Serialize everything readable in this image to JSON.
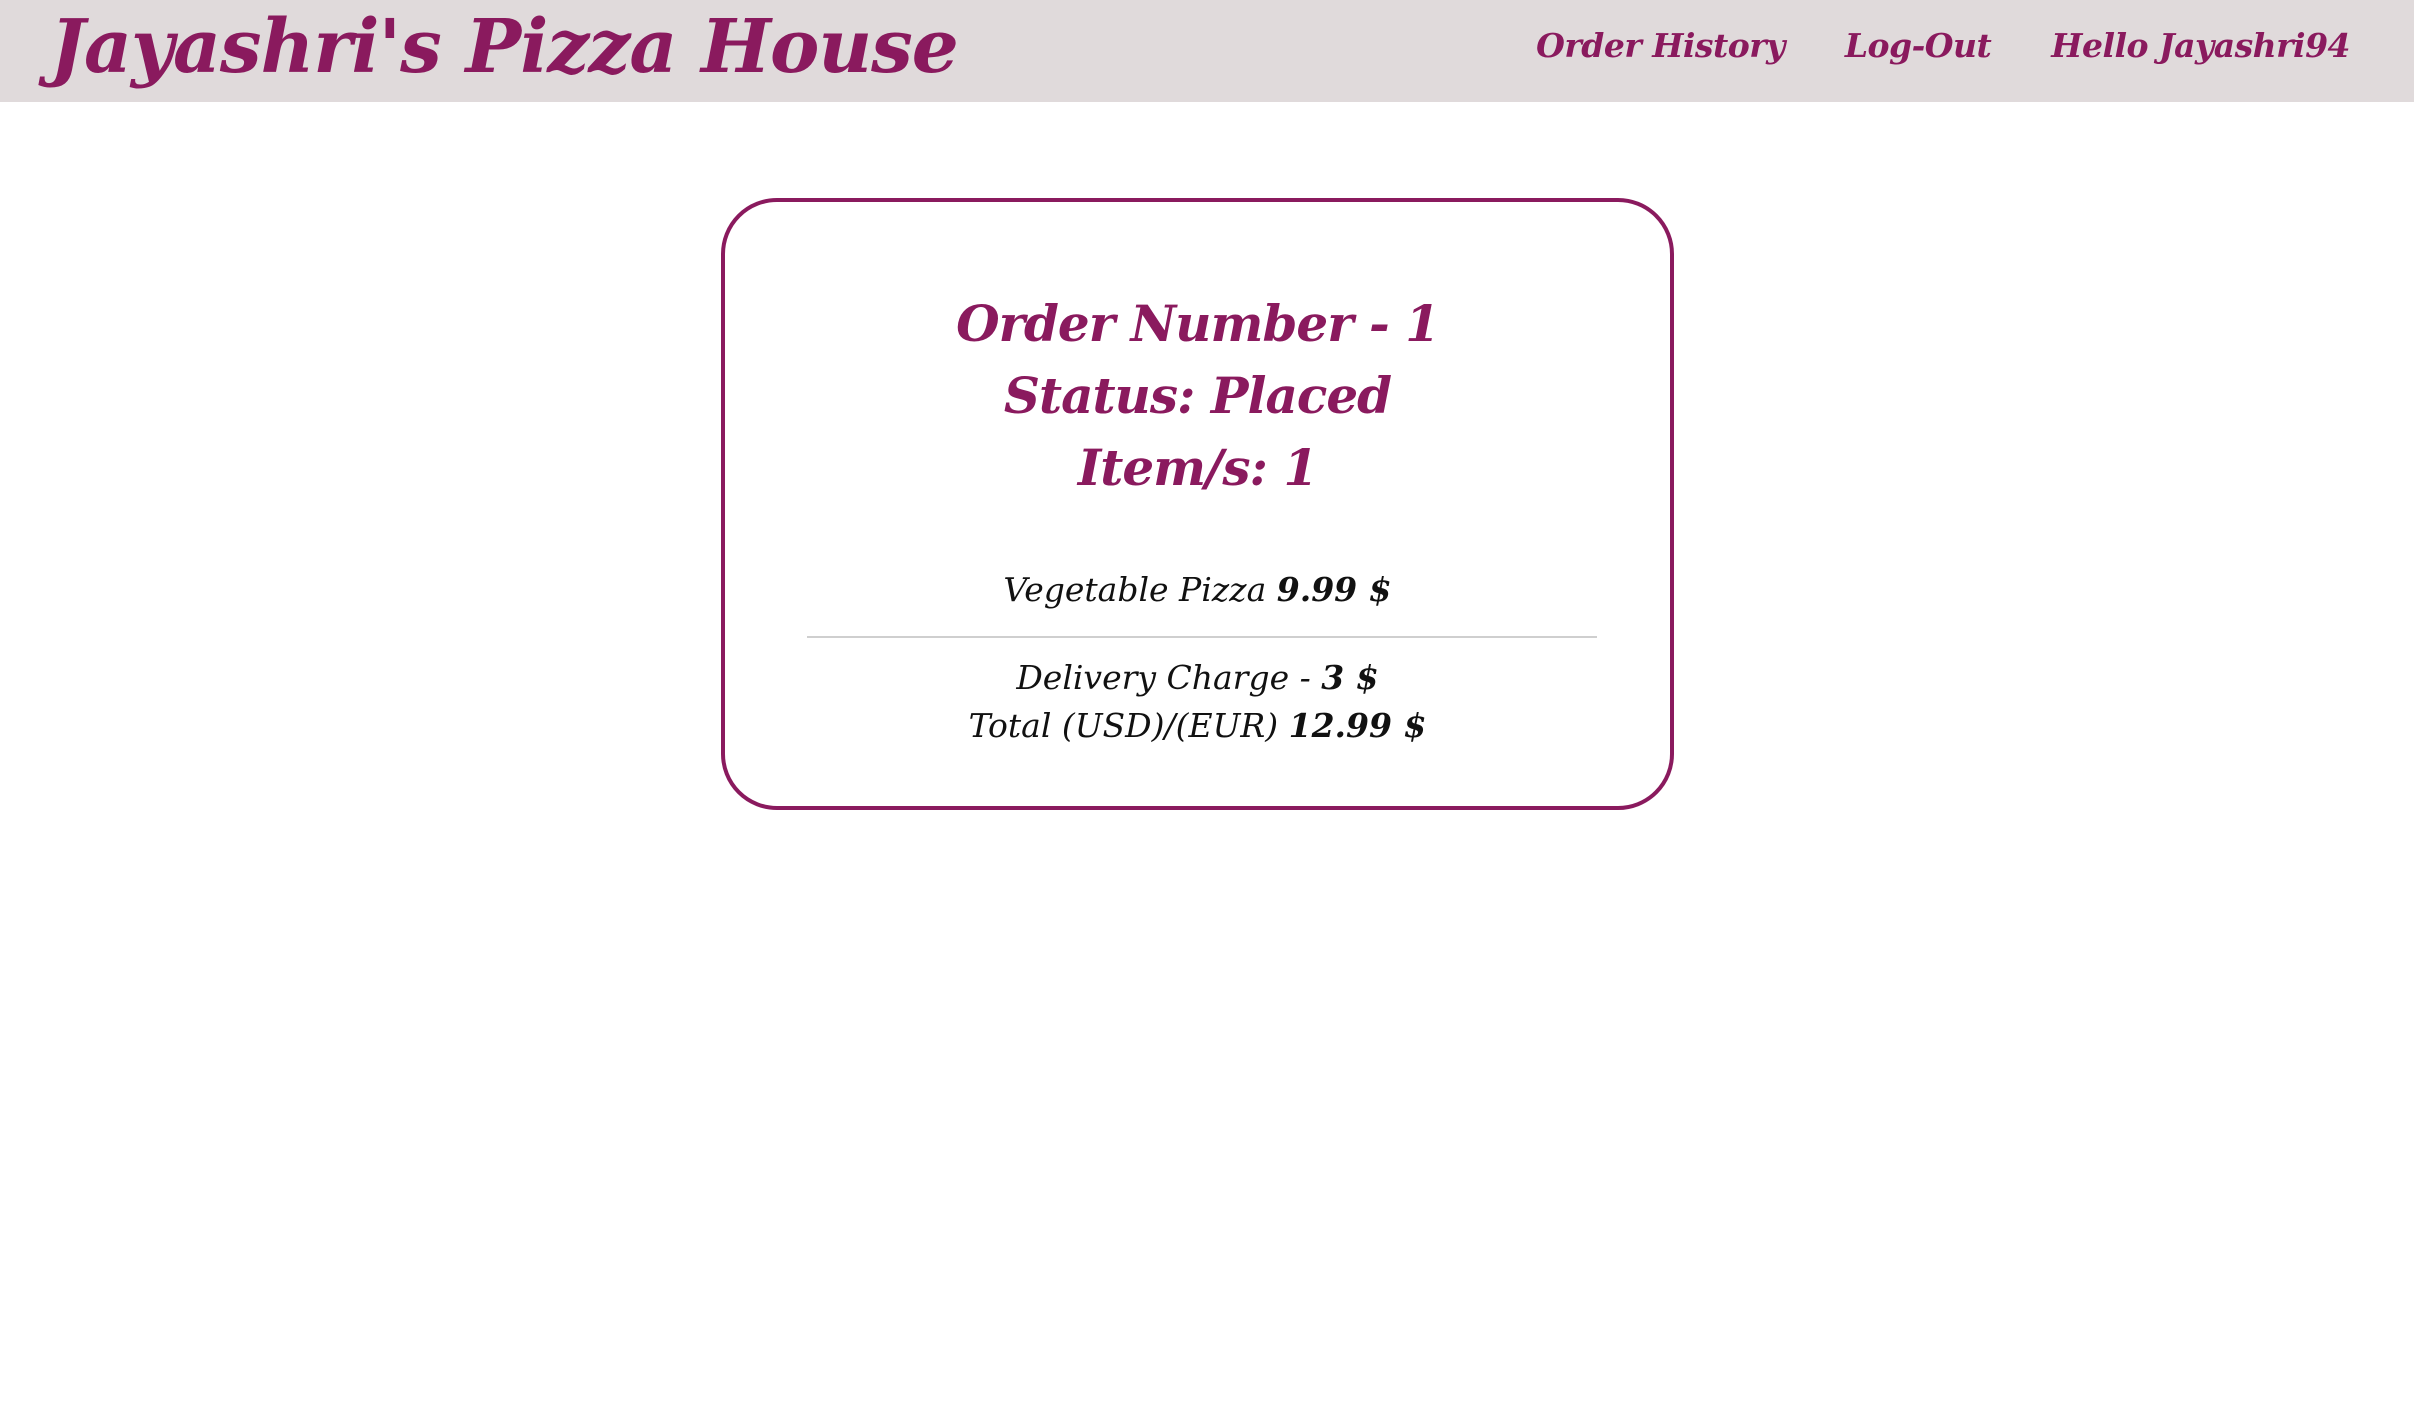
{
  "header": {
    "brand": "Jayashri's Pizza House",
    "nav": {
      "order_history": "Order History",
      "logout": "Log-Out",
      "greeting": "Hello Jayashri94"
    }
  },
  "order": {
    "number_label": "Order Number - 1",
    "status_label": "Status: Placed",
    "items_label": "Item/s: 1",
    "items": [
      {
        "name": "Vegetable Pizza",
        "price": "9.99 $"
      }
    ],
    "delivery_label": "Delivery Charge -",
    "delivery_amount": "3 $",
    "total_label": "Total (USD)/(EUR)",
    "total_amount": "12.99 $"
  },
  "colors": {
    "brand": "#8a1a5e",
    "navbar_bg": "#e0dadb",
    "text": "#111111"
  }
}
